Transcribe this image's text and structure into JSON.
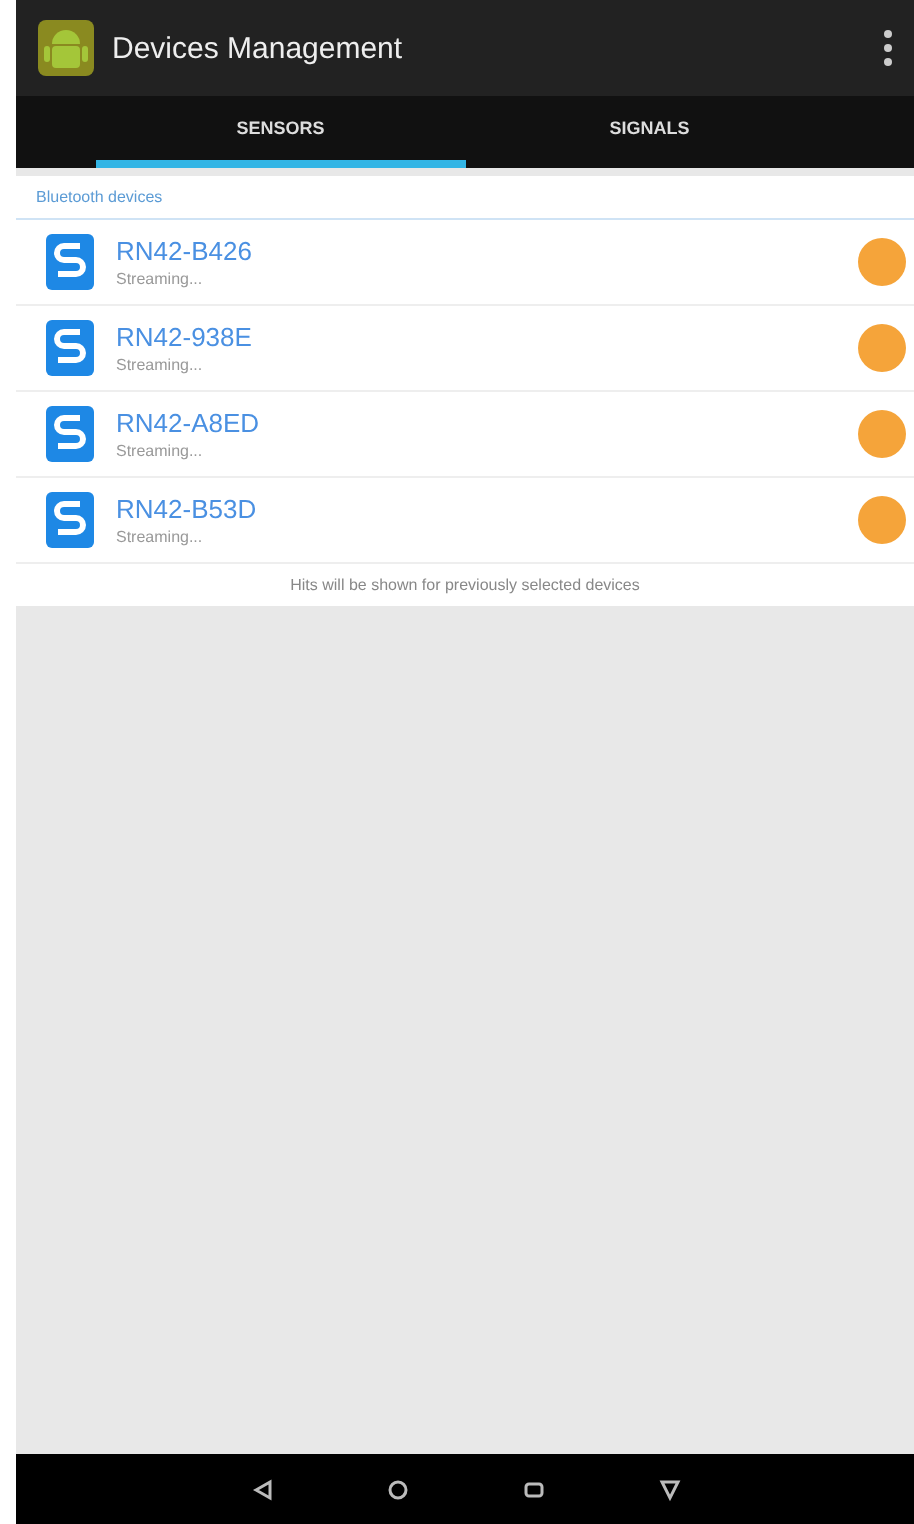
{
  "app_bar": {
    "title": "Devices Management"
  },
  "tabs": [
    {
      "label": "SENSORS",
      "selected": true
    },
    {
      "label": "SIGNALS",
      "selected": false
    }
  ],
  "section": {
    "title": "Bluetooth devices"
  },
  "devices": [
    {
      "name": "RN42-B426",
      "status": "Streaming..."
    },
    {
      "name": "RN42-938E",
      "status": "Streaming..."
    },
    {
      "name": "RN42-A8ED",
      "status": "Streaming..."
    },
    {
      "name": "RN42-B53D",
      "status": "Streaming..."
    }
  ],
  "footer_note": "Hits will be shown for previously selected devices"
}
